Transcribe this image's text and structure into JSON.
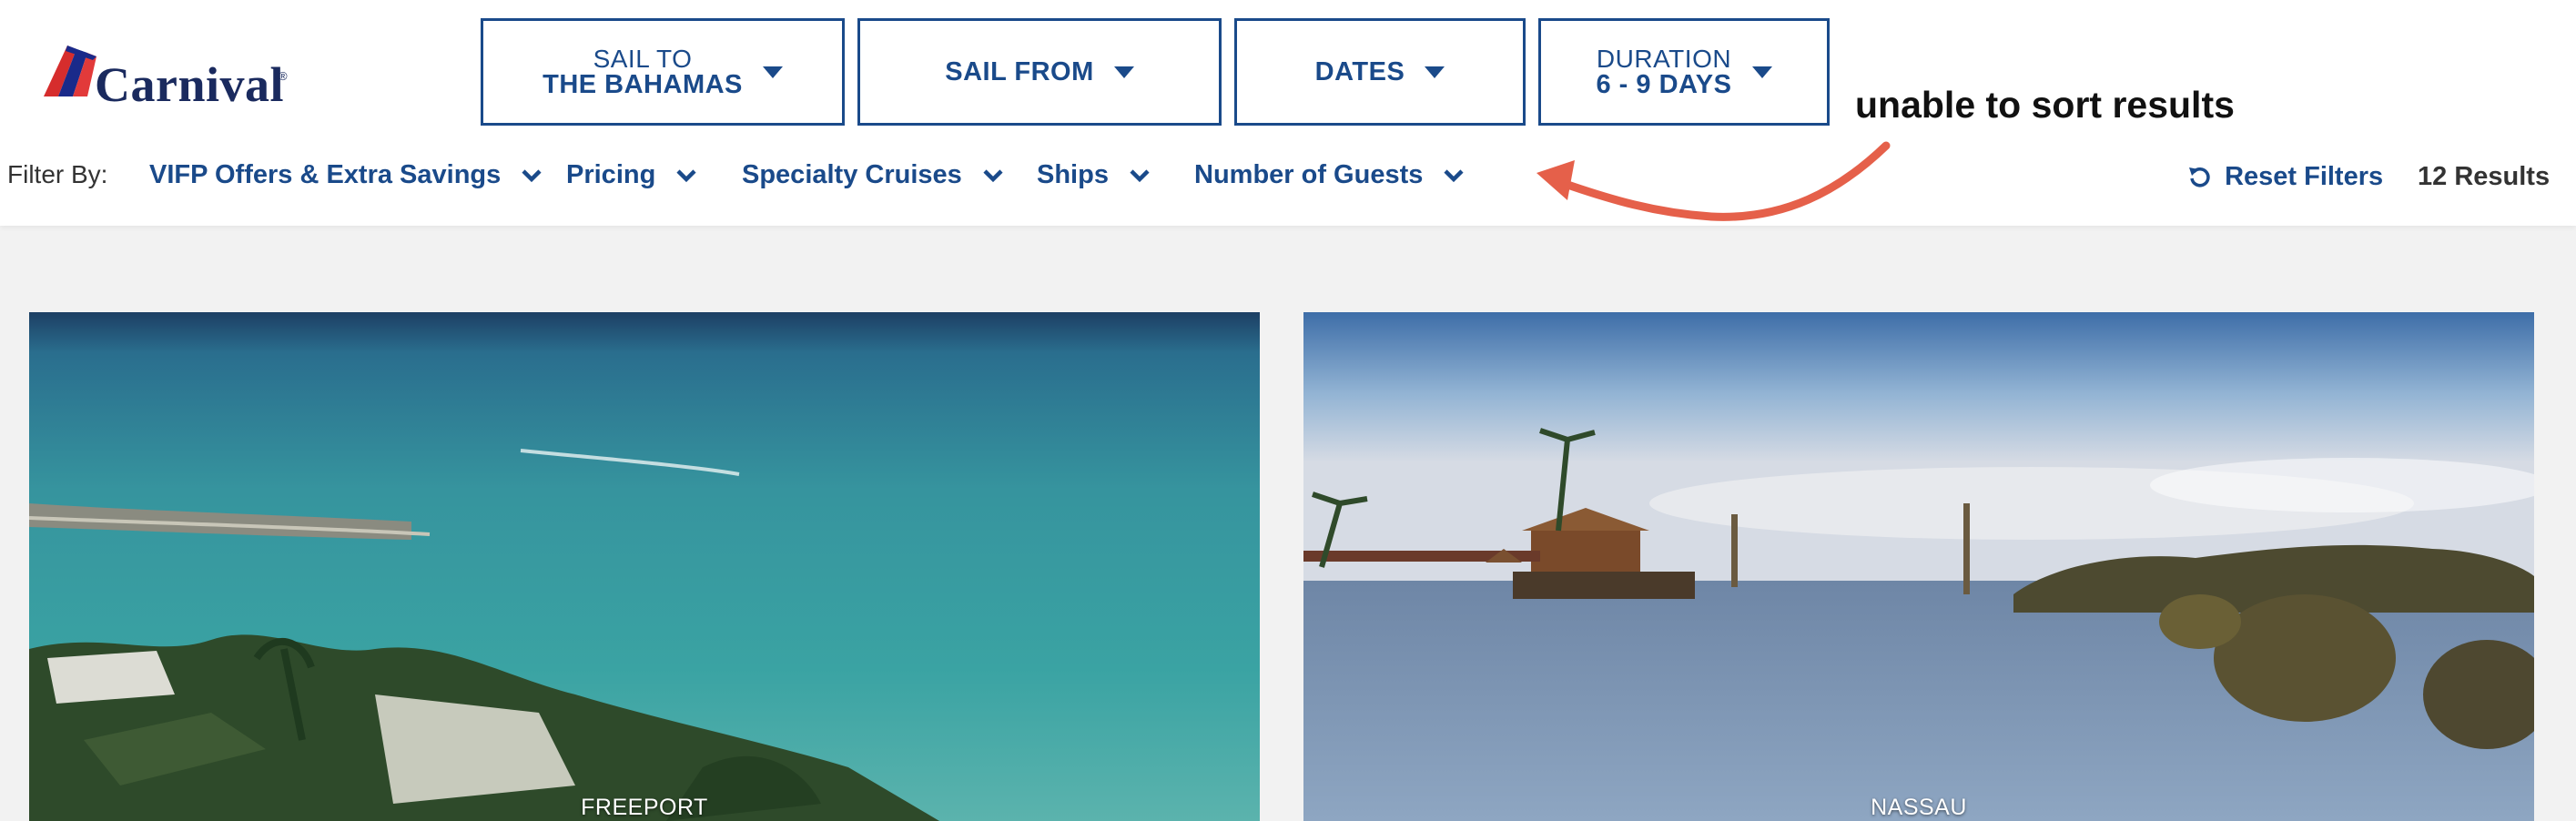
{
  "brand": {
    "name": "Carnival",
    "reg": "®"
  },
  "search": {
    "sail_to": {
      "label": "SAIL TO",
      "value": "THE BAHAMAS"
    },
    "sail_from": {
      "label": "SAIL FROM"
    },
    "dates": {
      "label": "DATES"
    },
    "duration": {
      "label": "DURATION",
      "value": "6 - 9 DAYS"
    }
  },
  "filters": {
    "label": "Filter By:",
    "items": [
      "VIFP Offers & Extra Savings",
      "Pricing",
      "Specialty Cruises",
      "Ships",
      "Number of Guests"
    ]
  },
  "annotation": {
    "text": "unable to sort results"
  },
  "reset": {
    "label": "Reset Filters"
  },
  "results": {
    "count": "12 Results"
  },
  "cards": [
    {
      "port": "FREEPORT"
    },
    {
      "port": "NASSAU"
    }
  ],
  "colors": {
    "brand_blue": "#1a4a8a",
    "annotation_arrow": "#e5604a",
    "page_bg": "#f2f2f2"
  },
  "icons": [
    "carnival-funnel-icon",
    "caret-down-icon",
    "chevron-down-icon",
    "reset-icon",
    "arrow-annotation-icon"
  ]
}
